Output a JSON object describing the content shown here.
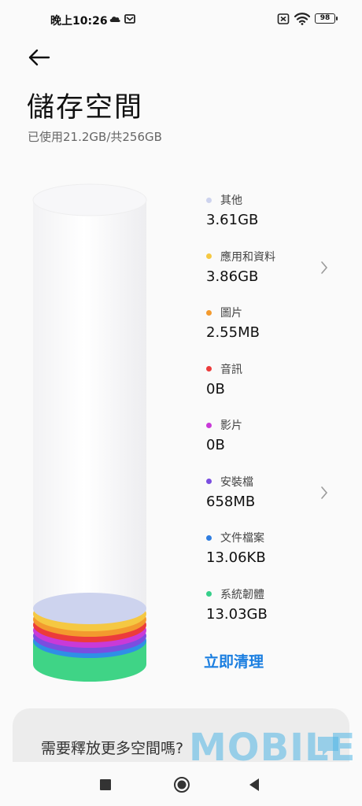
{
  "status_bar": {
    "time": "晚上10:26",
    "icons": [
      "cloud-icon",
      "mail-icon",
      "sim-off-icon",
      "wifi-icon",
      "battery-icon"
    ],
    "battery": "98"
  },
  "header": {
    "back_icon": "arrow-left-icon",
    "title": "儲存空間",
    "subtitle": "已使用21.2GB/共256GB"
  },
  "categories": [
    {
      "label": "其他",
      "value": "3.61GB",
      "color": "#cdd3ee",
      "has_chevron": false
    },
    {
      "label": "應用和資料",
      "value": "3.86GB",
      "color": "#f5c842",
      "has_chevron": true
    },
    {
      "label": "圖片",
      "value": "2.55MB",
      "color": "#f39a2e",
      "has_chevron": false
    },
    {
      "label": "音訊",
      "value": "0B",
      "color": "#ec3b3b",
      "has_chevron": false
    },
    {
      "label": "影片",
      "value": "0B",
      "color": "#c93ad8",
      "has_chevron": false
    },
    {
      "label": "安裝檔",
      "value": "658MB",
      "color": "#7a4ee0",
      "has_chevron": true
    },
    {
      "label": "文件檔案",
      "value": "13.06KB",
      "color": "#2f7de0",
      "has_chevron": false
    },
    {
      "label": "系統韌體",
      "value": "13.03GB",
      "color": "#36cf8a",
      "has_chevron": false
    }
  ],
  "actions": {
    "clean_label": "立即清理"
  },
  "free_card": {
    "text": "需要釋放更多空間嗎?"
  },
  "watermark": "MOBILE",
  "nav_bar": {
    "icons": [
      "recents-square-icon",
      "home-circle-icon",
      "back-triangle-icon"
    ]
  }
}
